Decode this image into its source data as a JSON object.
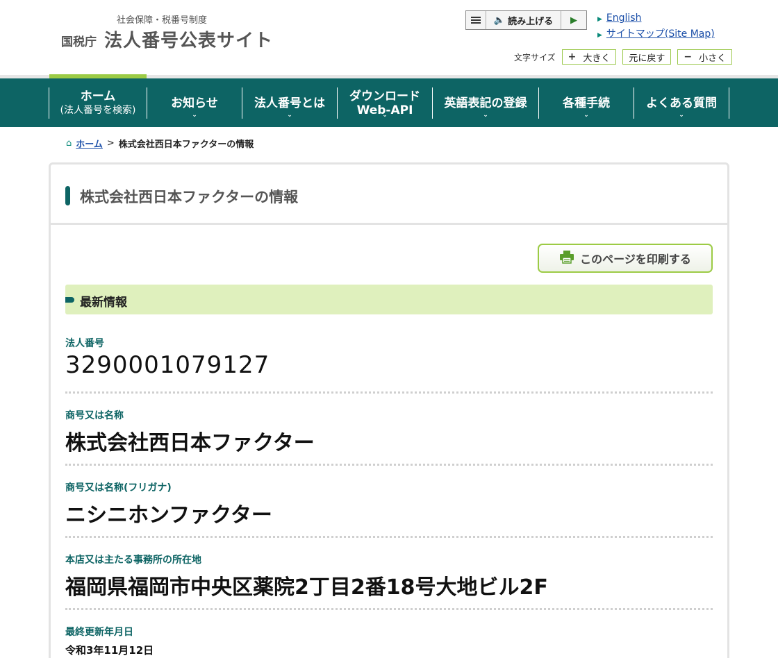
{
  "header": {
    "logo_subtitle": "社会保障・税番号制度",
    "logo_agency": "国税庁",
    "logo_title": "法人番号公表サイト",
    "readaloud_label": "読み上げる",
    "links": [
      {
        "label": "English"
      },
      {
        "label": "サイトマップ(Site Map)"
      }
    ],
    "fontsize_label": "文字サイズ",
    "fontsize_buttons": {
      "larger": "大きく",
      "reset": "元に戻す",
      "smaller": "小さく"
    }
  },
  "nav": {
    "items": [
      {
        "label": "ホーム",
        "sub": "(法人番号を検索)"
      },
      {
        "label": "お知らせ"
      },
      {
        "label": "法人番号とは"
      },
      {
        "label": "ダウンロード",
        "sub": "Web-API"
      },
      {
        "label": "英語表記の登録"
      },
      {
        "label": "各種手続"
      },
      {
        "label": "よくある質問"
      }
    ]
  },
  "breadcrumb": {
    "home": "ホーム",
    "separator": ">",
    "current": "株式会社西日本ファクターの情報"
  },
  "page": {
    "title": "株式会社西日本ファクターの情報",
    "print_label": "このページを印刷する",
    "section_title": "最新情報",
    "fields": [
      {
        "label": "法人番号",
        "value": "3290001079127"
      },
      {
        "label": "商号又は名称",
        "value": "株式会社西日本ファクター"
      },
      {
        "label": "商号又は名称(フリガナ)",
        "value": "ニシニホンファクター"
      },
      {
        "label": "本店又は主たる事務所の所在地",
        "value": "福岡県福岡市中央区薬院2丁目2番18号大地ビル2F"
      },
      {
        "label": "最終更新年月日",
        "value": "令和3年11月12日"
      }
    ]
  },
  "icons": {
    "menu": "menu-icon",
    "speaker": "speaker-icon",
    "play": "play-icon",
    "arrow": "arrow-right-icon",
    "home": "home-icon",
    "printer": "printer-icon",
    "chevron": "chevron-down-icon"
  },
  "colors": {
    "nav_bg": "#0d6464",
    "accent_green": "#9ccb45",
    "section_bg": "#dff0bd",
    "label_teal": "#0d6464",
    "link_blue": "#1a4ea8"
  }
}
